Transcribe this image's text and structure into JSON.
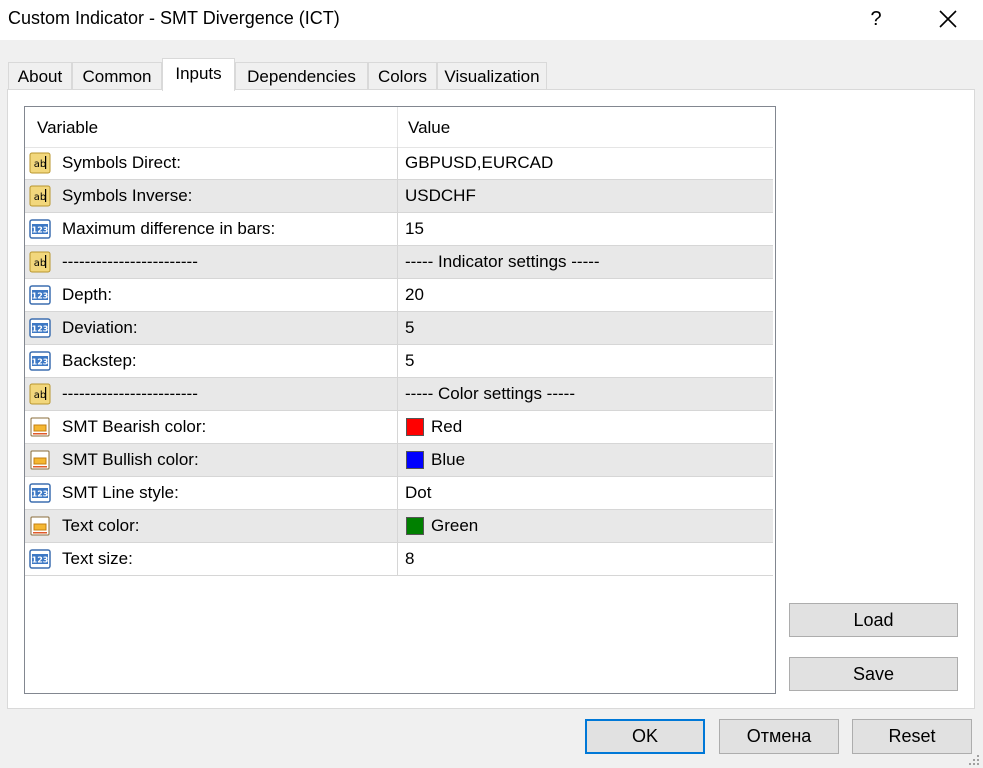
{
  "window": {
    "title": "Custom Indicator - SMT Divergence (ICT)",
    "help_label": "?"
  },
  "tabs": [
    "About",
    "Common",
    "Inputs",
    "Dependencies",
    "Colors",
    "Visualization"
  ],
  "active_tab": "Inputs",
  "grid": {
    "header": {
      "variable": "Variable",
      "value": "Value"
    },
    "rows": [
      {
        "icon": "string-type-icon",
        "variable": "Symbols Direct:",
        "value": "GBPUSD,EURCAD"
      },
      {
        "icon": "string-type-icon",
        "variable": "Symbols Inverse:",
        "value": "USDCHF"
      },
      {
        "icon": "integer-type-icon",
        "variable": "Maximum difference in bars:",
        "value": "15"
      },
      {
        "icon": "string-type-icon",
        "variable": "------------------------",
        "value": "----- Indicator settings -----"
      },
      {
        "icon": "integer-type-icon",
        "variable": "Depth:",
        "value": "20"
      },
      {
        "icon": "integer-type-icon",
        "variable": "Deviation:",
        "value": "5"
      },
      {
        "icon": "integer-type-icon",
        "variable": "Backstep:",
        "value": "5"
      },
      {
        "icon": "string-type-icon",
        "variable": "------------------------",
        "value": "----- Color settings -----"
      },
      {
        "icon": "color-type-icon",
        "variable": "SMT Bearish color:",
        "value": "Red",
        "swatch": "#ff0000"
      },
      {
        "icon": "color-type-icon",
        "variable": "SMT Bullish color:",
        "value": "Blue",
        "swatch": "#0000ff"
      },
      {
        "icon": "integer-type-icon",
        "variable": "SMT Line style:",
        "value": "Dot"
      },
      {
        "icon": "color-type-icon",
        "variable": "Text color:",
        "value": "Green",
        "swatch": "#008000"
      },
      {
        "icon": "integer-type-icon",
        "variable": "Text size:",
        "value": "8"
      }
    ]
  },
  "buttons": {
    "load": "Load",
    "save": "Save",
    "ok": "OK",
    "cancel": "Отмена",
    "reset": "Reset"
  },
  "colors": {
    "accent": "#0078d7",
    "row_alt": "#e8e8e8"
  }
}
